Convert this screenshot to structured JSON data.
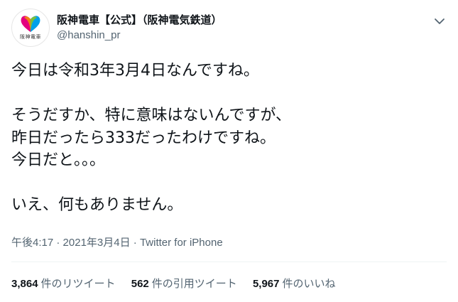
{
  "account": {
    "display_name": "阪神電車【公式】（阪神電気鉄道）",
    "handle": "@hanshin_pr",
    "avatar_logo_text": "阪神電車"
  },
  "tweet": {
    "lines": [
      "今日は令和3年3月4日なんですね。",
      "",
      "そうだすか、特に意味はないんですが、",
      "昨日だったら333だったわけですね。",
      "今日だと。。。",
      "",
      "いえ、何もありません。"
    ]
  },
  "meta": {
    "time": "午後4:17",
    "separator1": " · ",
    "date": "2021年3月4日",
    "separator2": " · ",
    "source": "Twitter for iPhone"
  },
  "stats": [
    {
      "count": "3,864",
      "label": "件のリツイート"
    },
    {
      "count": "562",
      "label": "件の引用ツイート"
    },
    {
      "count": "5,967",
      "label": "件のいいね"
    }
  ],
  "colors": {
    "text": "#0f1419",
    "secondary": "#536471",
    "divider": "#eff3f4",
    "logo_colors": [
      "#e4007f",
      "#f39800",
      "#8fc31f",
      "#00a0e9"
    ]
  },
  "icons": {
    "more": "chevron-down-icon"
  }
}
